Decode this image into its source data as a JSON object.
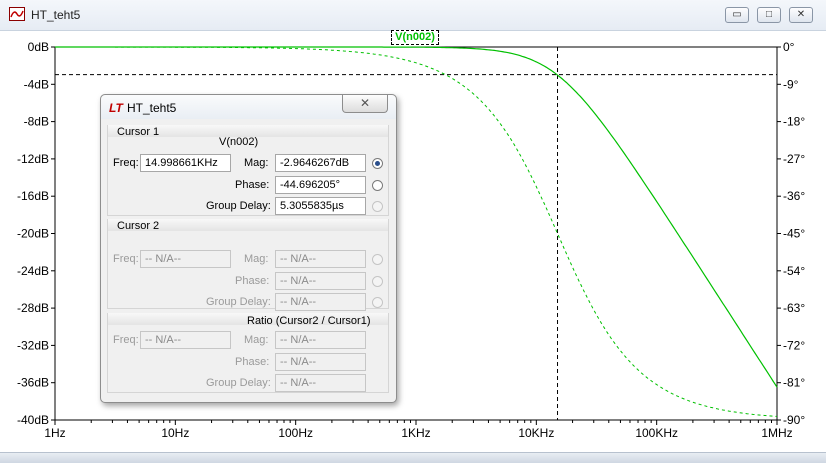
{
  "window": {
    "title": "HT_teht5",
    "min_glyph": "▭",
    "max_glyph": "□",
    "close_glyph": "✕"
  },
  "trace": {
    "name": "V(n002)",
    "color": "#00c000"
  },
  "axes": {
    "left_ticks": [
      "0dB",
      "-4dB",
      "-8dB",
      "-12dB",
      "-16dB",
      "-20dB",
      "-24dB",
      "-28dB",
      "-32dB",
      "-36dB",
      "-40dB"
    ],
    "right_ticks": [
      "0°",
      "-9°",
      "-18°",
      "-27°",
      "-36°",
      "-45°",
      "-54°",
      "-63°",
      "-72°",
      "-81°",
      "-90°"
    ],
    "x_ticks": [
      "1Hz",
      "10Hz",
      "100Hz",
      "1KHz",
      "10KHz",
      "100KHz",
      "1MHz"
    ]
  },
  "chart_data": {
    "type": "line",
    "x_scale": "log",
    "xlim": [
      1,
      1000000
    ],
    "ylim_left": [
      -40,
      0
    ],
    "ylim_right": [
      -90,
      0
    ],
    "corner_frequency": 15000,
    "series": [
      {
        "style": "solid",
        "axis": "left",
        "quantity": "magnitude_db"
      },
      {
        "style": "dashed",
        "axis": "right",
        "quantity": "phase_deg"
      }
    ],
    "cursor": {
      "x": 14998.661,
      "y_db": -2.9646267
    },
    "grid": false
  },
  "dialog": {
    "title": "HT_teht5",
    "cursor1": {
      "header": "Cursor 1",
      "trace": "V(n002)",
      "freq_label": "Freq:",
      "freq": "14.998661KHz",
      "mag_label": "Mag:",
      "mag": "-2.9646267dB",
      "phase_label": "Phase:",
      "phase": "-44.696205°",
      "gd_label": "Group Delay:",
      "gd": "5.3055835µs"
    },
    "cursor2": {
      "header": "Cursor 2",
      "freq_label": "Freq:",
      "freq": "-- N/A--",
      "mag_label": "Mag:",
      "mag": "-- N/A--",
      "phase_label": "Phase:",
      "phase": "-- N/A--",
      "gd_label": "Group Delay:",
      "gd": "-- N/A--"
    },
    "ratio": {
      "header": "Ratio (Cursor2 / Cursor1)",
      "freq_label": "Freq:",
      "freq": "-- N/A--",
      "mag_label": "Mag:",
      "mag": "-- N/A--",
      "phase_label": "Phase:",
      "phase": "-- N/A--",
      "gd_label": "Group Delay:",
      "gd": "-- N/A--"
    }
  }
}
